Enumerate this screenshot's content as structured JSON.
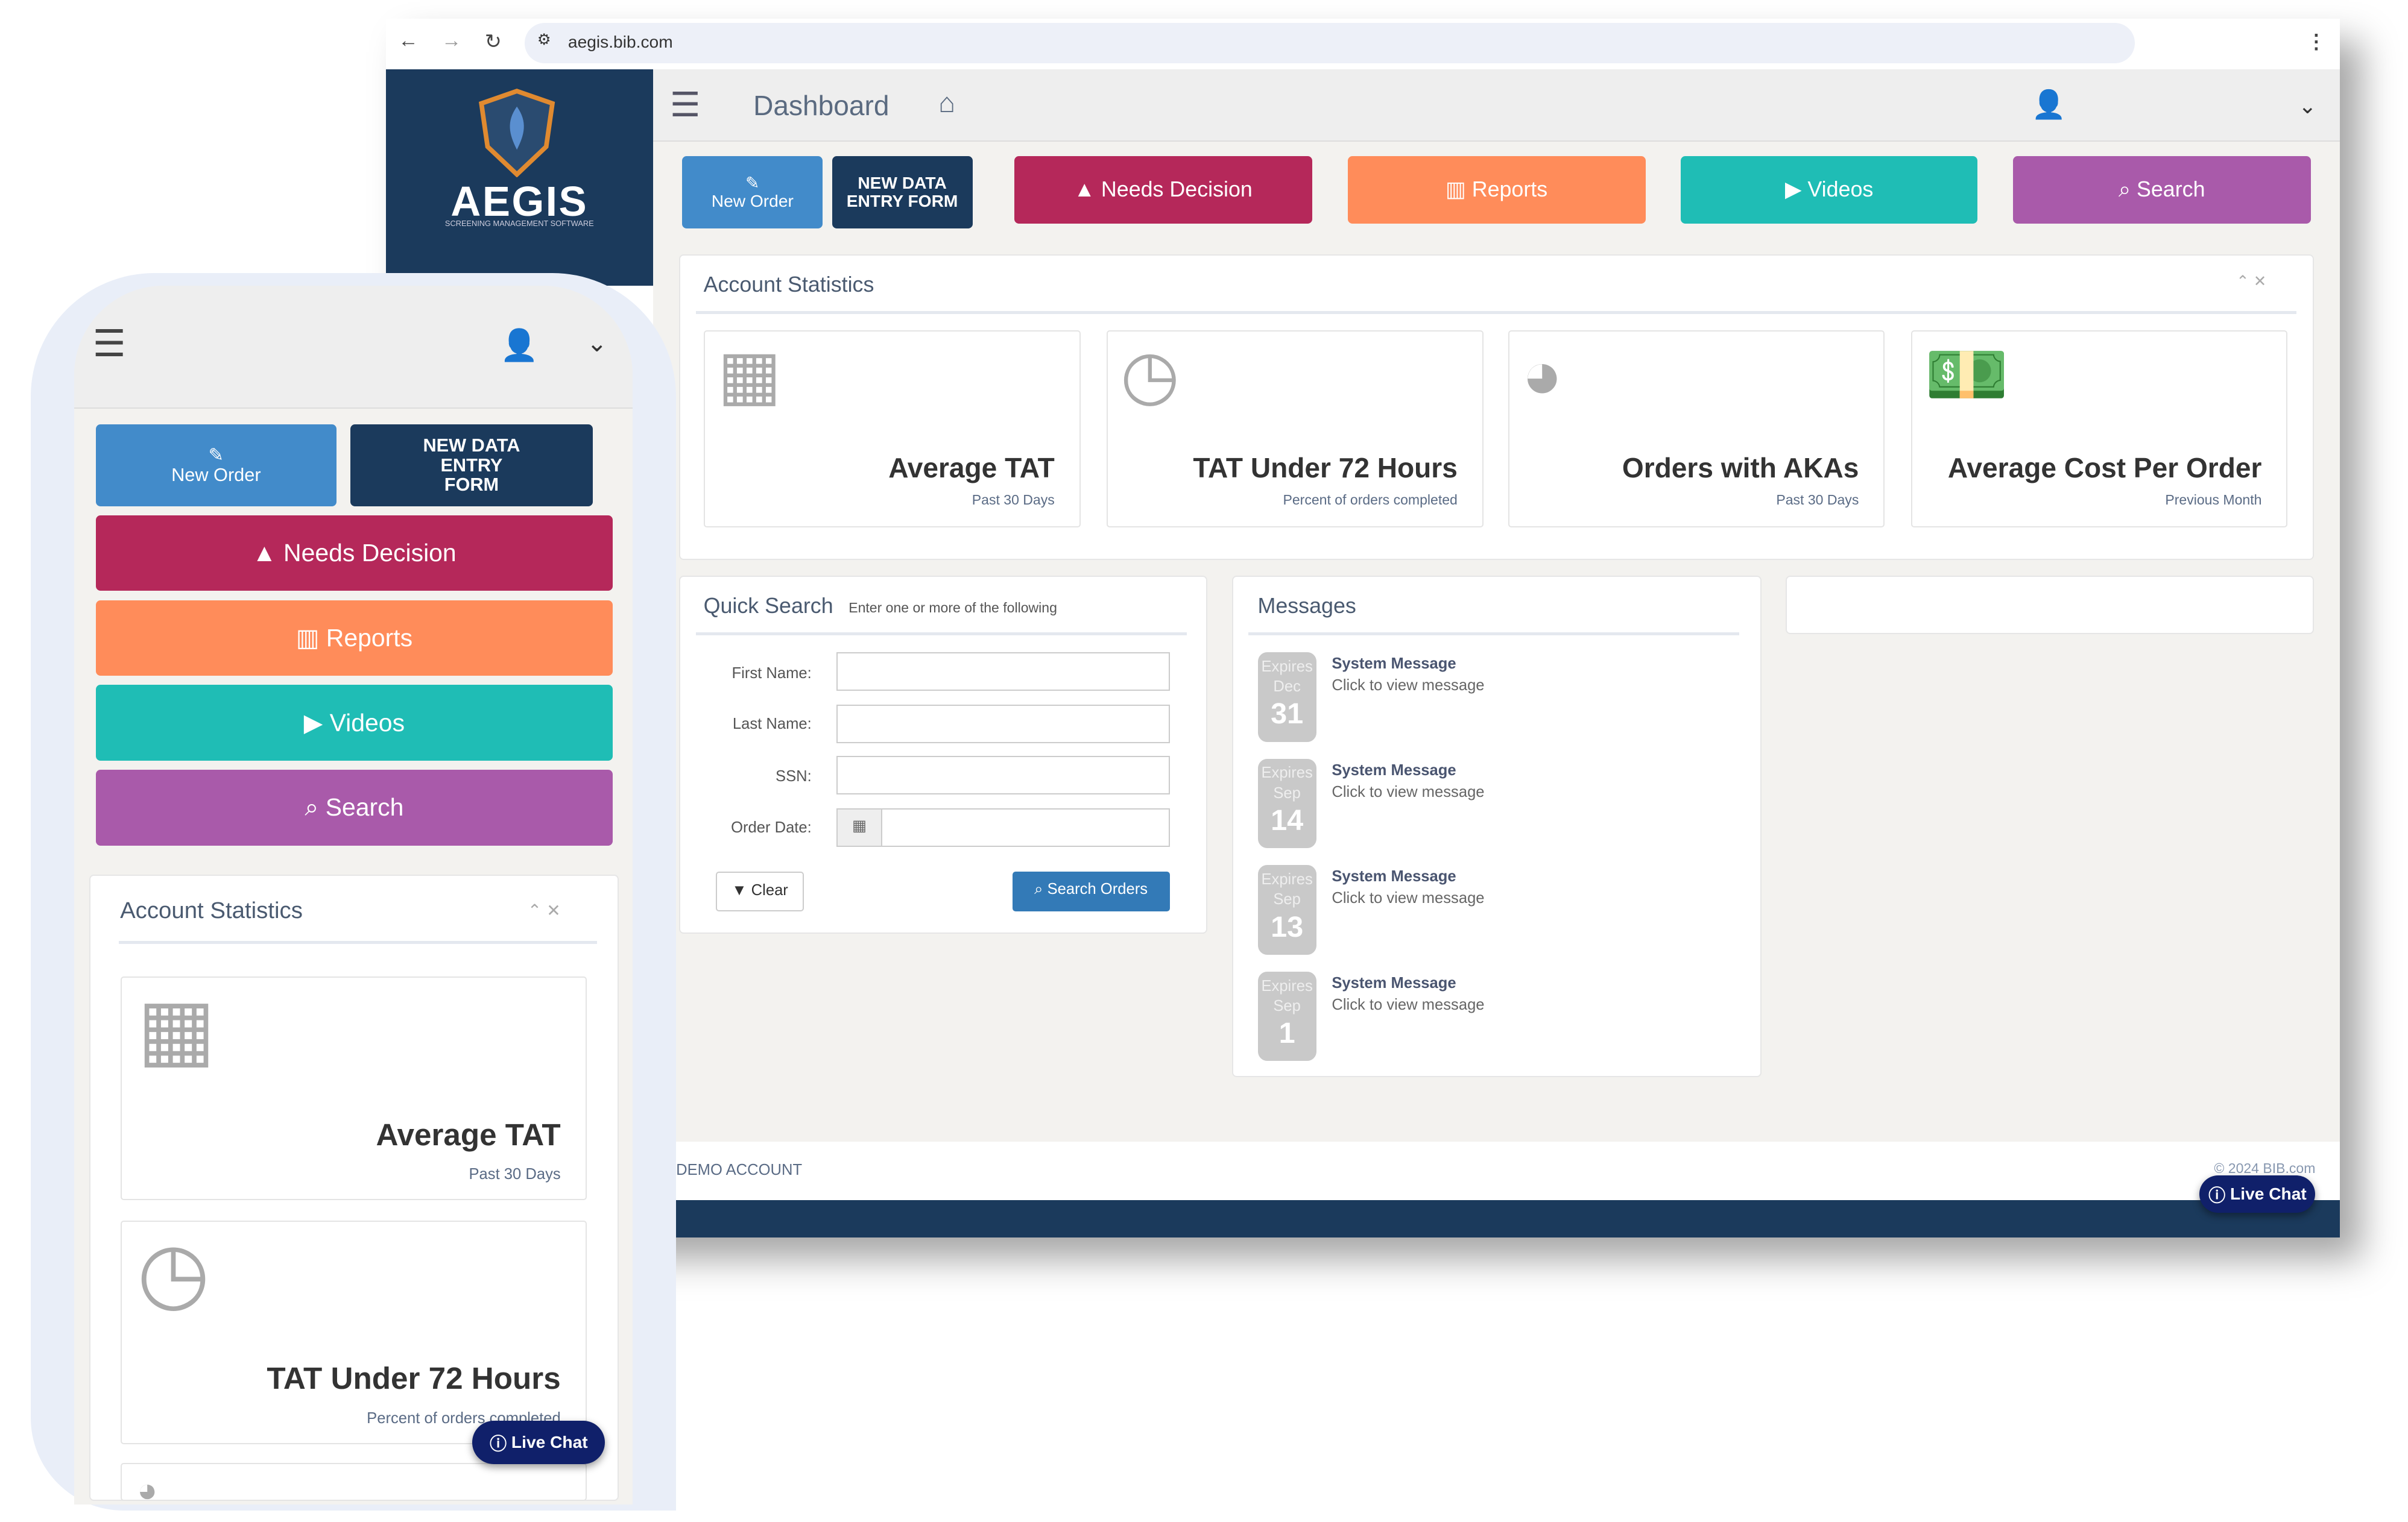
{
  "browser": {
    "url": "aegis.bib.com"
  },
  "brand": {
    "name": "AEGIS",
    "tagline": "SCREENING MANAGEMENT SOFTWARE"
  },
  "header": {
    "title": "Dashboard"
  },
  "actions": {
    "new_order": "New Order",
    "new_data_entry": "NEW DATA ENTRY FORM",
    "needs_decision": "Needs Decision",
    "reports": "Reports",
    "videos": "Videos",
    "search": "Search"
  },
  "colors": {
    "new_order": "#428bca",
    "new_data_entry": "#1b3a5c",
    "needs_decision": "#b5285a",
    "reports": "#ff8c5a",
    "videos": "#1fbdb5",
    "search": "#a95aaa",
    "navy": "#1b3a5c"
  },
  "account_statistics": {
    "title": "Account Statistics",
    "cards": [
      {
        "title": "Average TAT",
        "subtitle": "Past 30 Days",
        "icon": "calendar-icon"
      },
      {
        "title": "TAT Under 72 Hours",
        "subtitle": "Percent of orders completed",
        "icon": "clock-icon"
      },
      {
        "title": "Orders with AKAs",
        "subtitle": "Past 30 Days",
        "icon": "pie-chart-icon"
      },
      {
        "title": "Average Cost Per Order",
        "subtitle": "Previous Month",
        "icon": "money-icon"
      }
    ]
  },
  "quick_search": {
    "title": "Quick Search",
    "hint": "Enter one or more of the following",
    "first_name": "First Name:",
    "last_name": "Last Name:",
    "ssn": "SSN:",
    "order_date": "Order Date:",
    "clear": "Clear",
    "search_orders": "Search Orders"
  },
  "messages": {
    "title": "Messages",
    "items": [
      {
        "expires": "Expires",
        "month": "Dec",
        "day": "31",
        "title": "System Message",
        "text": "Click to view message"
      },
      {
        "expires": "Expires",
        "month": "Sep",
        "day": "14",
        "title": "System Message",
        "text": "Click to view message"
      },
      {
        "expires": "Expires",
        "month": "Sep",
        "day": "13",
        "title": "System Message",
        "text": "Click to view message"
      },
      {
        "expires": "Expires",
        "month": "Sep",
        "day": "1",
        "title": "System Message",
        "text": "Click to view message"
      }
    ]
  },
  "footer": {
    "account": "DEMO ACCOUNT",
    "copyright": "© 2024 BIB.com"
  },
  "live_chat": "Live Chat"
}
